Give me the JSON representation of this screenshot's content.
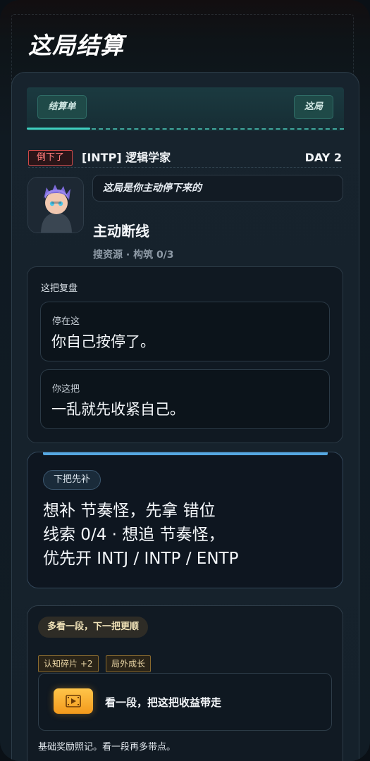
{
  "page": {
    "title": "这局结算"
  },
  "progress": {
    "left_chip": "结算单",
    "right_chip": "这局"
  },
  "header": {
    "status_badge": "倒下了",
    "role": "[INTP] 逻辑学家",
    "day": "DAY 2"
  },
  "character": {
    "speech": "这局是你主动停下来的",
    "status_title": "主动断线",
    "status_sub": "搜资源 · 构筑 0/3"
  },
  "review": {
    "label": "这把复盘",
    "items": [
      {
        "label": "停在这",
        "value": "你自己按停了。"
      },
      {
        "label": "你这把",
        "value": "一乱就先收紧自己。"
      }
    ]
  },
  "plan": {
    "tag": "下把先补",
    "lines": [
      "想补 节奏怪，先拿 错位",
      "线索 0/4 · 想追 节奏怪，",
      "优先开 INTJ / INTP / ENTP"
    ]
  },
  "bonus": {
    "pill": "多看一段，下一把更顺",
    "tags": [
      "认知碎片 +2",
      "局外成长"
    ],
    "watch_label": "看一段，把这把收益带走",
    "footnote": "基础奖励照记。看一段再多带点。"
  },
  "colors": {
    "accent_teal": "#3fd0c0",
    "danger": "#d04848",
    "plan_accent": "#55a8e2",
    "gold": "#f39a1c"
  }
}
